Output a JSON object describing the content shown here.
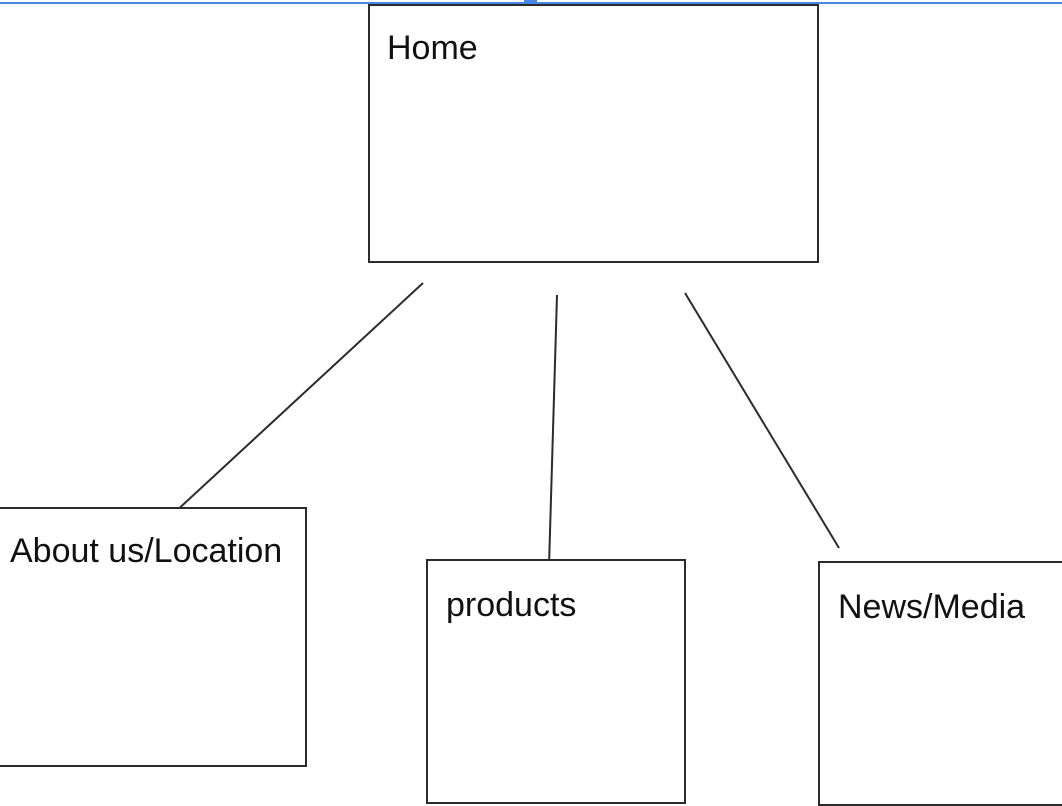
{
  "diagram": {
    "root": {
      "label": "Home"
    },
    "children": [
      {
        "id": "about",
        "label": "About us/Location"
      },
      {
        "id": "products",
        "label": "products"
      },
      {
        "id": "news",
        "label": "News/Media"
      }
    ]
  },
  "colors": {
    "selection": "#4a86e8",
    "stroke": "#2b2b2b",
    "text": "#111111"
  }
}
